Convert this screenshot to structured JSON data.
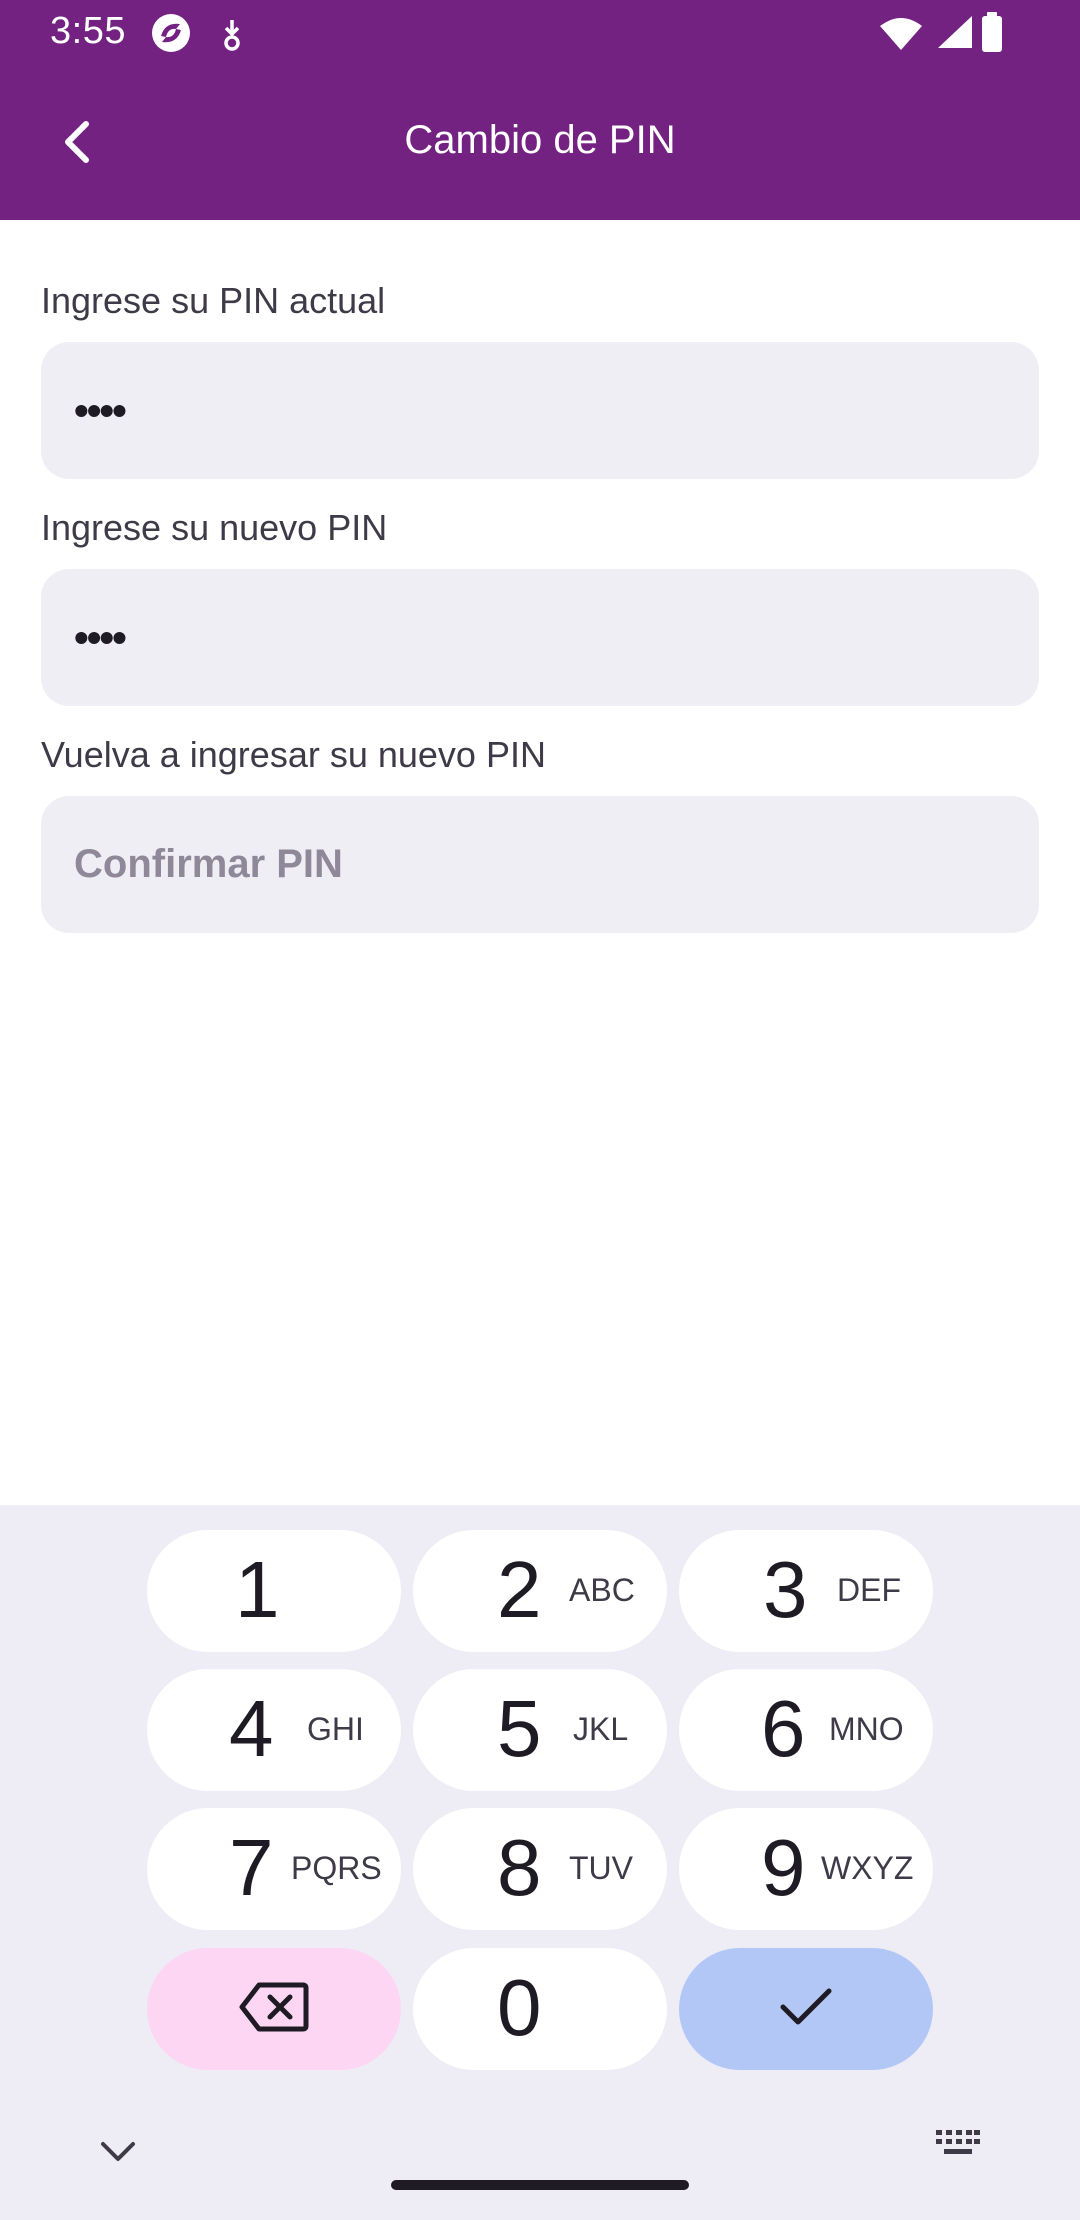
{
  "status_bar": {
    "time": "3:55"
  },
  "header": {
    "title": "Cambio de PIN"
  },
  "form": {
    "current_pin": {
      "label": "Ingrese su PIN actual",
      "value": "••••"
    },
    "new_pin": {
      "label": "Ingrese su nuevo PIN",
      "value": "••••"
    },
    "confirm_pin": {
      "label": "Vuelva a ingresar su nuevo PIN",
      "placeholder": "Confirmar PIN"
    }
  },
  "keypad": {
    "keys": [
      {
        "digit": "1",
        "letters": ""
      },
      {
        "digit": "2",
        "letters": "ABC"
      },
      {
        "digit": "3",
        "letters": "DEF"
      },
      {
        "digit": "4",
        "letters": "GHI"
      },
      {
        "digit": "5",
        "letters": "JKL"
      },
      {
        "digit": "6",
        "letters": "MNO"
      },
      {
        "digit": "7",
        "letters": "PQRS"
      },
      {
        "digit": "8",
        "letters": "TUV"
      },
      {
        "digit": "9",
        "letters": "WXYZ"
      },
      {
        "digit": "0",
        "letters": ""
      }
    ]
  },
  "colors": {
    "header_bg": "#732281",
    "field_bg": "#f0eef5",
    "backspace_key": "#fdd6f4",
    "done_key": "#b3c7f7"
  },
  "icons": {
    "back": "arrow-back-icon",
    "backspace": "backspace-icon",
    "done": "check-icon",
    "collapse": "chevron-down-icon",
    "keyboard": "keyboard-icon"
  }
}
